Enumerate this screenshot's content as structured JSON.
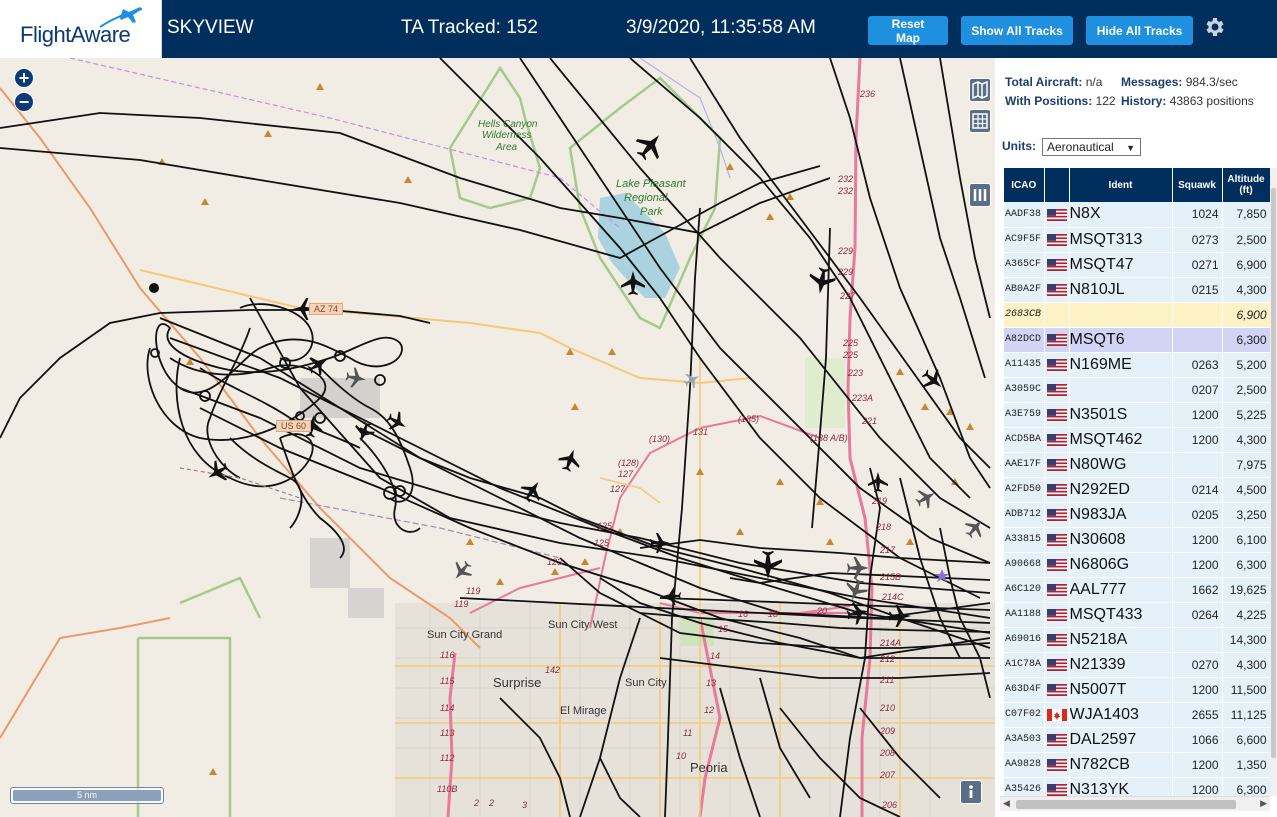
{
  "header": {
    "logo_text": "FlightAware",
    "app_name": "SKYVIEW",
    "ta_tracked": "TA Tracked: 152",
    "clock": "3/9/2020, 11:35:58 AM",
    "reset_map": "Reset Map",
    "show_all_tracks": "Show All Tracks",
    "hide_all_tracks": "Hide All Tracks",
    "settings_icon": "gear-icon"
  },
  "map": {
    "zoom_in": "+",
    "zoom_out": "−",
    "scale_label": "5 nm",
    "labels": {
      "hells_canyon": "Hells Canyon",
      "wilderness": "Wilderness",
      "area": "Area",
      "lake_pleasant": "Lake Pleasant",
      "regional": "Regional",
      "park": "Park",
      "az74": "AZ 74",
      "us60": "US 60",
      "sun_city_grand": "Sun City Grand",
      "sun_city_west": "Sun City West",
      "surprise": "Surprise",
      "sun_city": "Sun City",
      "el_mirage": "El Mirage",
      "peoria": "Peoria",
      "r130": "(130)",
      "r131": "131",
      "r135": "(135)",
      "r138": "(138 A/B)",
      "r128": "(128)",
      "r127a": "127",
      "r127b": "127",
      "r125a": "125",
      "r125b": "125",
      "r123": "123",
      "r119a": "119",
      "r119b": "119",
      "r116": "116",
      "r115": "115",
      "r114": "114",
      "r113": "113",
      "r112": "112",
      "r110b": "110B",
      "r142": "142",
      "r236": "236",
      "r232a": "232",
      "r232b": "232",
      "r229a": "229",
      "r229b": "229",
      "r227": "227",
      "r225a": "225",
      "r225b": "225",
      "r223": "223",
      "r223a": "223A",
      "r221": "221",
      "r219": "219",
      "r218": "218",
      "r217": "217",
      "r215b": "215B",
      "r214c": "214C",
      "r214a": "214A",
      "r212": "212",
      "r211": "211",
      "r210": "210",
      "r209": "209",
      "r208": "208",
      "r207": "207",
      "r206": "206",
      "r16": "16",
      "r18": "18",
      "r20": "20",
      "r15": "15",
      "r14": "14",
      "r13": "13",
      "r12": "12",
      "r11": "11",
      "r10": "10",
      "r2a": "2",
      "r2b": "2",
      "r3": "3"
    }
  },
  "sidebar": {
    "total_aircraft_label": "Total Aircraft:",
    "total_aircraft_value": "n/a",
    "messages_label": "Messages:",
    "messages_value": "984.3/sec",
    "with_positions_label": "With Positions:",
    "with_positions_value": "122",
    "history_label": "History:",
    "history_value": "43863 positions",
    "units_label": "Units:",
    "units_value": "Aeronautical",
    "columns": {
      "icao": "ICAO",
      "flag": "",
      "ident": "Ident",
      "squawk": "Squawk",
      "altitude": "Altitude (ft)"
    },
    "rows": [
      {
        "icao": "AADF38",
        "flag": "us",
        "ident": "N8X",
        "squawk": "1024",
        "alt": "7,850",
        "style": "blue"
      },
      {
        "icao": "AC9F5F",
        "flag": "us",
        "ident": "MSQT313",
        "squawk": "0273",
        "alt": "2,500",
        "style": "blue"
      },
      {
        "icao": "A365CF",
        "flag": "us",
        "ident": "MSQT47",
        "squawk": "0271",
        "alt": "6,900",
        "style": "blue"
      },
      {
        "icao": "AB0A2F",
        "flag": "us",
        "ident": "N810JL",
        "squawk": "0215",
        "alt": "4,300",
        "style": "blue"
      },
      {
        "icao": "2683CB",
        "flag": "",
        "ident": "",
        "squawk": "",
        "alt": "6,900",
        "style": "yellow"
      },
      {
        "icao": "A82DCD",
        "flag": "us",
        "ident": "MSQT6",
        "squawk": "",
        "alt": "6,300",
        "style": "purple"
      },
      {
        "icao": "A11435",
        "flag": "us",
        "ident": "N169ME",
        "squawk": "0263",
        "alt": "5,200",
        "style": "blue"
      },
      {
        "icao": "A3059C",
        "flag": "us",
        "ident": "",
        "squawk": "0207",
        "alt": "2,500",
        "style": "blue"
      },
      {
        "icao": "A3E759",
        "flag": "us",
        "ident": "N3501S",
        "squawk": "1200",
        "alt": "5,225",
        "style": "blue"
      },
      {
        "icao": "ACD5BA",
        "flag": "us",
        "ident": "MSQT462",
        "squawk": "1200",
        "alt": "4,300",
        "style": "blue"
      },
      {
        "icao": "AAE17F",
        "flag": "us",
        "ident": "N80WG",
        "squawk": "",
        "alt": "7,975",
        "style": "blue"
      },
      {
        "icao": "A2FD50",
        "flag": "us",
        "ident": "N292ED",
        "squawk": "0214",
        "alt": "4,500",
        "style": "blue"
      },
      {
        "icao": "ADB712",
        "flag": "us",
        "ident": "N983JA",
        "squawk": "0205",
        "alt": "3,250",
        "style": "blue"
      },
      {
        "icao": "A33815",
        "flag": "us",
        "ident": "N30608",
        "squawk": "1200",
        "alt": "6,100",
        "style": "blue"
      },
      {
        "icao": "A90668",
        "flag": "us",
        "ident": "N6806G",
        "squawk": "1200",
        "alt": "6,300",
        "style": "blue"
      },
      {
        "icao": "A6C120",
        "flag": "us",
        "ident": "AAL777",
        "squawk": "1662",
        "alt": "19,625",
        "style": "blue"
      },
      {
        "icao": "AA1188",
        "flag": "us",
        "ident": "MSQT433",
        "squawk": "0264",
        "alt": "4,225",
        "style": "blue"
      },
      {
        "icao": "A69016",
        "flag": "us",
        "ident": "N5218A",
        "squawk": "",
        "alt": "14,300",
        "style": "blue"
      },
      {
        "icao": "A1C78A",
        "flag": "us",
        "ident": "N21339",
        "squawk": "0270",
        "alt": "4,300",
        "style": "blue"
      },
      {
        "icao": "A63D4F",
        "flag": "us",
        "ident": "N5007T",
        "squawk": "1200",
        "alt": "11,500",
        "style": "blue"
      },
      {
        "icao": "C07F02",
        "flag": "ca",
        "ident": "WJA1403",
        "squawk": "2655",
        "alt": "11,125",
        "style": "blue"
      },
      {
        "icao": "A3A503",
        "flag": "us",
        "ident": "DAL2597",
        "squawk": "1066",
        "alt": "6,600",
        "style": "blue"
      },
      {
        "icao": "AA9828",
        "flag": "us",
        "ident": "N782CB",
        "squawk": "1200",
        "alt": "1,350",
        "style": "blue"
      },
      {
        "icao": "A35426",
        "flag": "us",
        "ident": "N313YK",
        "squawk": "1200",
        "alt": "6,300",
        "style": "blue"
      }
    ]
  },
  "colors": {
    "header_bg": "#002f5d",
    "button_blue": "#1f8fe0",
    "row_blue": "#e5f1f9",
    "row_yellow": "#fdf1c6",
    "row_selected": "#d2d4f6",
    "track": "#111111",
    "road_orange": "#ea9a6a",
    "park_green": "#a5c98a",
    "lake": "#aad3df"
  }
}
